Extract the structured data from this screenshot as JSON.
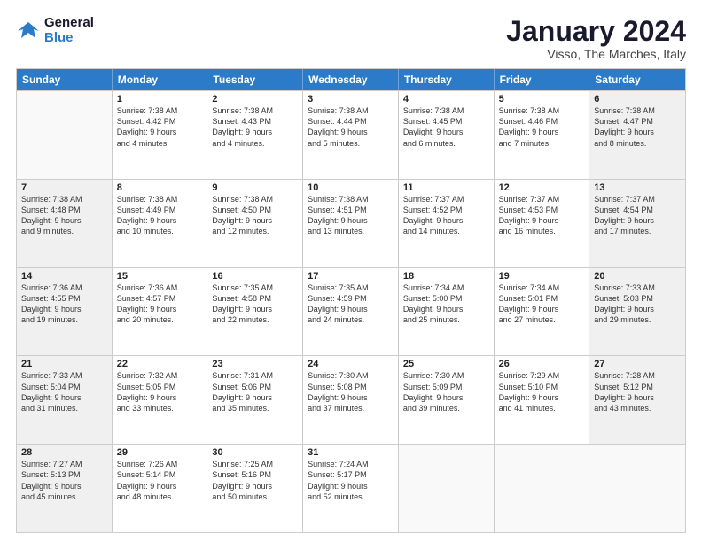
{
  "logo": {
    "line1": "General",
    "line2": "Blue"
  },
  "title": "January 2024",
  "subtitle": "Visso, The Marches, Italy",
  "days": [
    "Sunday",
    "Monday",
    "Tuesday",
    "Wednesday",
    "Thursday",
    "Friday",
    "Saturday"
  ],
  "weeks": [
    [
      {
        "num": "",
        "text": "",
        "empty": true,
        "shaded": false
      },
      {
        "num": "1",
        "text": "Sunrise: 7:38 AM\nSunset: 4:42 PM\nDaylight: 9 hours\nand 4 minutes.",
        "empty": false,
        "shaded": false
      },
      {
        "num": "2",
        "text": "Sunrise: 7:38 AM\nSunset: 4:43 PM\nDaylight: 9 hours\nand 4 minutes.",
        "empty": false,
        "shaded": false
      },
      {
        "num": "3",
        "text": "Sunrise: 7:38 AM\nSunset: 4:44 PM\nDaylight: 9 hours\nand 5 minutes.",
        "empty": false,
        "shaded": false
      },
      {
        "num": "4",
        "text": "Sunrise: 7:38 AM\nSunset: 4:45 PM\nDaylight: 9 hours\nand 6 minutes.",
        "empty": false,
        "shaded": false
      },
      {
        "num": "5",
        "text": "Sunrise: 7:38 AM\nSunset: 4:46 PM\nDaylight: 9 hours\nand 7 minutes.",
        "empty": false,
        "shaded": false
      },
      {
        "num": "6",
        "text": "Sunrise: 7:38 AM\nSunset: 4:47 PM\nDaylight: 9 hours\nand 8 minutes.",
        "empty": false,
        "shaded": true
      }
    ],
    [
      {
        "num": "7",
        "text": "Sunrise: 7:38 AM\nSunset: 4:48 PM\nDaylight: 9 hours\nand 9 minutes.",
        "empty": false,
        "shaded": true
      },
      {
        "num": "8",
        "text": "Sunrise: 7:38 AM\nSunset: 4:49 PM\nDaylight: 9 hours\nand 10 minutes.",
        "empty": false,
        "shaded": false
      },
      {
        "num": "9",
        "text": "Sunrise: 7:38 AM\nSunset: 4:50 PM\nDaylight: 9 hours\nand 12 minutes.",
        "empty": false,
        "shaded": false
      },
      {
        "num": "10",
        "text": "Sunrise: 7:38 AM\nSunset: 4:51 PM\nDaylight: 9 hours\nand 13 minutes.",
        "empty": false,
        "shaded": false
      },
      {
        "num": "11",
        "text": "Sunrise: 7:37 AM\nSunset: 4:52 PM\nDaylight: 9 hours\nand 14 minutes.",
        "empty": false,
        "shaded": false
      },
      {
        "num": "12",
        "text": "Sunrise: 7:37 AM\nSunset: 4:53 PM\nDaylight: 9 hours\nand 16 minutes.",
        "empty": false,
        "shaded": false
      },
      {
        "num": "13",
        "text": "Sunrise: 7:37 AM\nSunset: 4:54 PM\nDaylight: 9 hours\nand 17 minutes.",
        "empty": false,
        "shaded": true
      }
    ],
    [
      {
        "num": "14",
        "text": "Sunrise: 7:36 AM\nSunset: 4:55 PM\nDaylight: 9 hours\nand 19 minutes.",
        "empty": false,
        "shaded": true
      },
      {
        "num": "15",
        "text": "Sunrise: 7:36 AM\nSunset: 4:57 PM\nDaylight: 9 hours\nand 20 minutes.",
        "empty": false,
        "shaded": false
      },
      {
        "num": "16",
        "text": "Sunrise: 7:35 AM\nSunset: 4:58 PM\nDaylight: 9 hours\nand 22 minutes.",
        "empty": false,
        "shaded": false
      },
      {
        "num": "17",
        "text": "Sunrise: 7:35 AM\nSunset: 4:59 PM\nDaylight: 9 hours\nand 24 minutes.",
        "empty": false,
        "shaded": false
      },
      {
        "num": "18",
        "text": "Sunrise: 7:34 AM\nSunset: 5:00 PM\nDaylight: 9 hours\nand 25 minutes.",
        "empty": false,
        "shaded": false
      },
      {
        "num": "19",
        "text": "Sunrise: 7:34 AM\nSunset: 5:01 PM\nDaylight: 9 hours\nand 27 minutes.",
        "empty": false,
        "shaded": false
      },
      {
        "num": "20",
        "text": "Sunrise: 7:33 AM\nSunset: 5:03 PM\nDaylight: 9 hours\nand 29 minutes.",
        "empty": false,
        "shaded": true
      }
    ],
    [
      {
        "num": "21",
        "text": "Sunrise: 7:33 AM\nSunset: 5:04 PM\nDaylight: 9 hours\nand 31 minutes.",
        "empty": false,
        "shaded": true
      },
      {
        "num": "22",
        "text": "Sunrise: 7:32 AM\nSunset: 5:05 PM\nDaylight: 9 hours\nand 33 minutes.",
        "empty": false,
        "shaded": false
      },
      {
        "num": "23",
        "text": "Sunrise: 7:31 AM\nSunset: 5:06 PM\nDaylight: 9 hours\nand 35 minutes.",
        "empty": false,
        "shaded": false
      },
      {
        "num": "24",
        "text": "Sunrise: 7:30 AM\nSunset: 5:08 PM\nDaylight: 9 hours\nand 37 minutes.",
        "empty": false,
        "shaded": false
      },
      {
        "num": "25",
        "text": "Sunrise: 7:30 AM\nSunset: 5:09 PM\nDaylight: 9 hours\nand 39 minutes.",
        "empty": false,
        "shaded": false
      },
      {
        "num": "26",
        "text": "Sunrise: 7:29 AM\nSunset: 5:10 PM\nDaylight: 9 hours\nand 41 minutes.",
        "empty": false,
        "shaded": false
      },
      {
        "num": "27",
        "text": "Sunrise: 7:28 AM\nSunset: 5:12 PM\nDaylight: 9 hours\nand 43 minutes.",
        "empty": false,
        "shaded": true
      }
    ],
    [
      {
        "num": "28",
        "text": "Sunrise: 7:27 AM\nSunset: 5:13 PM\nDaylight: 9 hours\nand 45 minutes.",
        "empty": false,
        "shaded": true
      },
      {
        "num": "29",
        "text": "Sunrise: 7:26 AM\nSunset: 5:14 PM\nDaylight: 9 hours\nand 48 minutes.",
        "empty": false,
        "shaded": false
      },
      {
        "num": "30",
        "text": "Sunrise: 7:25 AM\nSunset: 5:16 PM\nDaylight: 9 hours\nand 50 minutes.",
        "empty": false,
        "shaded": false
      },
      {
        "num": "31",
        "text": "Sunrise: 7:24 AM\nSunset: 5:17 PM\nDaylight: 9 hours\nand 52 minutes.",
        "empty": false,
        "shaded": false
      },
      {
        "num": "",
        "text": "",
        "empty": true,
        "shaded": false
      },
      {
        "num": "",
        "text": "",
        "empty": true,
        "shaded": false
      },
      {
        "num": "",
        "text": "",
        "empty": true,
        "shaded": false
      }
    ]
  ]
}
